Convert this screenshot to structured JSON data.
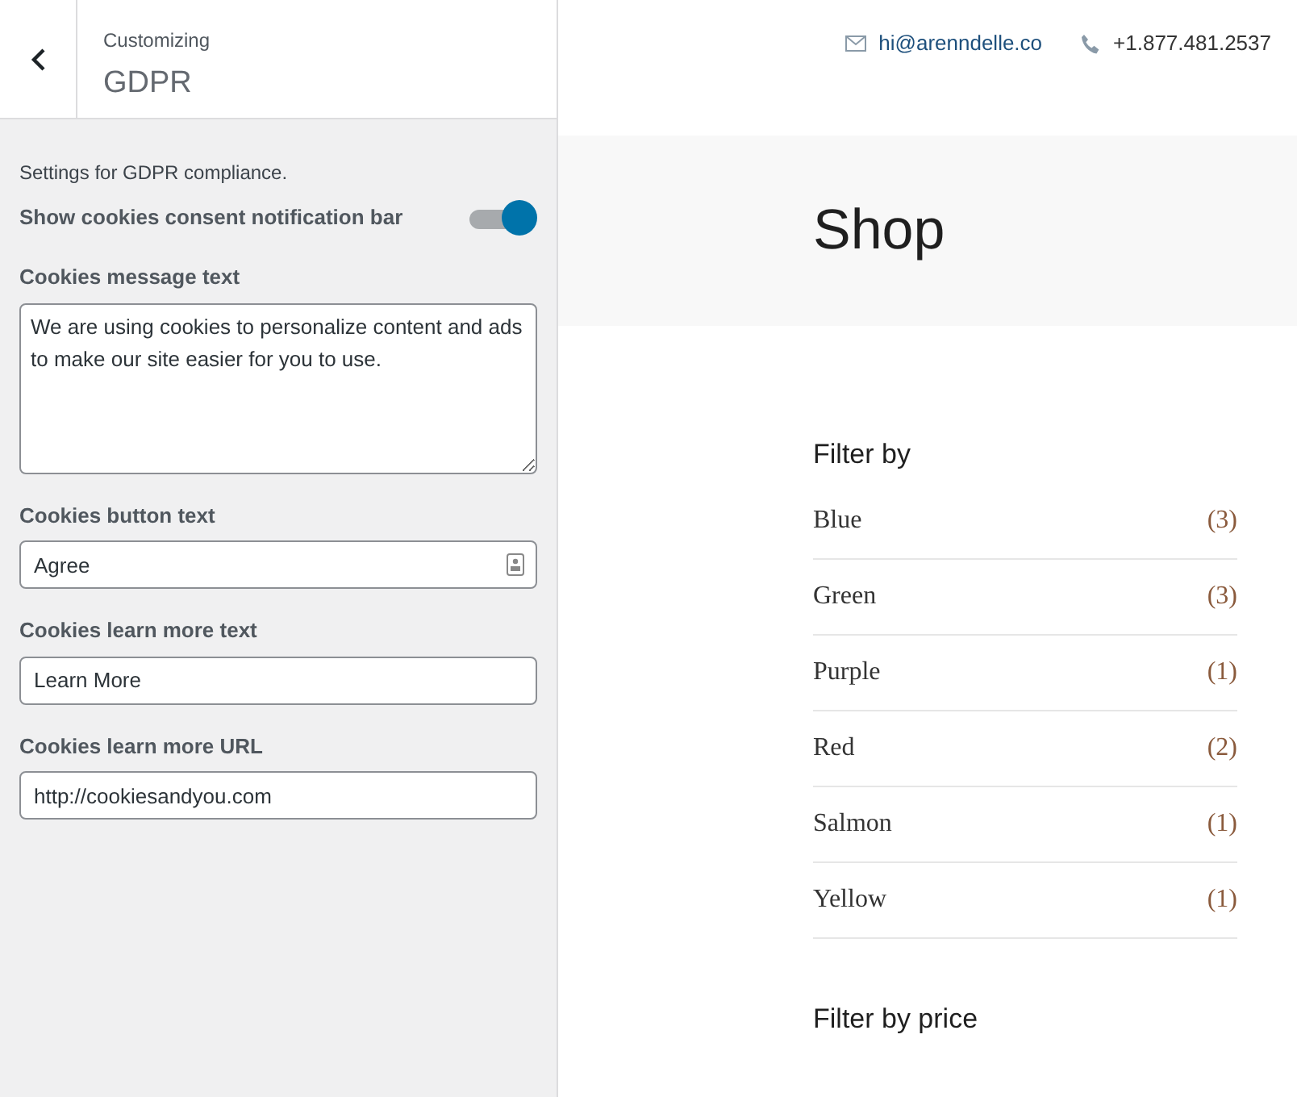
{
  "panel": {
    "breadcrumb": "Customizing",
    "title": "GDPR",
    "description": "Settings for GDPR compliance.",
    "toggle": {
      "label": "Show cookies consent notification bar",
      "on": true
    },
    "fields": [
      {
        "kind": "textarea",
        "label": "Cookies message text",
        "value": "We are using cookies to personalize content and ads to make our site easier for you to use."
      },
      {
        "kind": "input",
        "label": "Cookies button text",
        "value": "Agree",
        "autofill_icon": true
      },
      {
        "kind": "input",
        "label": "Cookies learn more text",
        "value": "Learn More"
      },
      {
        "kind": "input",
        "label": "Cookies learn more URL",
        "value": "http://cookiesandyou.com"
      }
    ]
  },
  "preview": {
    "email": "hi@arenndelle.co",
    "phone": "+1.877.481.2537",
    "page_title": "Shop",
    "filter_title": "Filter by",
    "filters": [
      {
        "name": "Blue",
        "count": "(3)"
      },
      {
        "name": "Green",
        "count": "(3)"
      },
      {
        "name": "Purple",
        "count": "(1)"
      },
      {
        "name": "Red",
        "count": "(2)"
      },
      {
        "name": "Salmon",
        "count": "(1)"
      },
      {
        "name": "Yellow",
        "count": "(1)"
      }
    ],
    "price_title": "Filter by price"
  }
}
